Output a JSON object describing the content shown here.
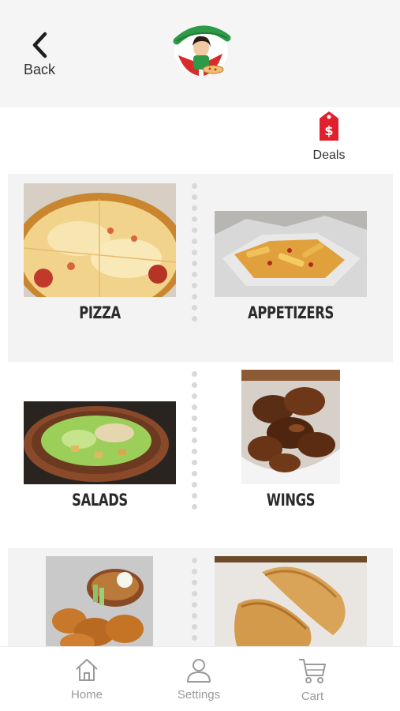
{
  "header": {
    "back_label": "Back"
  },
  "deals": {
    "label": "Deals"
  },
  "categories": [
    {
      "label": "PIZZA"
    },
    {
      "label": "APPETIZERS"
    },
    {
      "label": "SALADS"
    },
    {
      "label": "WINGS"
    },
    {
      "label": ""
    },
    {
      "label": ""
    }
  ],
  "tabbar": {
    "items": [
      {
        "label": "Home"
      },
      {
        "label": "Settings"
      },
      {
        "label": "Cart"
      }
    ]
  },
  "colors": {
    "accent_red": "#e0202e",
    "header_bg": "#f5f5f5",
    "row_gray": "#f3f3f3",
    "tab_gray": "#9a9a9a"
  }
}
